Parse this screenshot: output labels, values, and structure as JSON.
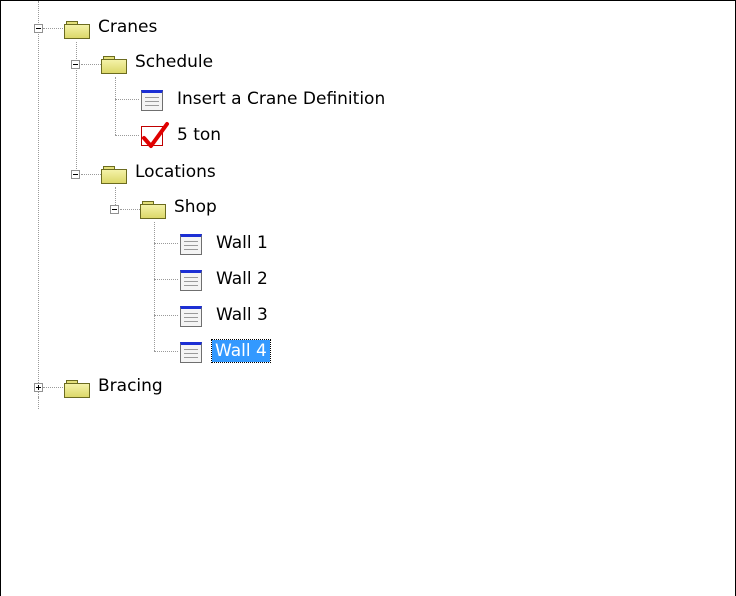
{
  "tree": {
    "cranes": {
      "label": "Cranes",
      "icon": "folder-icon",
      "expanded": true
    },
    "schedule": {
      "label": "Schedule",
      "icon": "folder-icon",
      "expanded": true
    },
    "insert_crane_definition": {
      "label": "Insert a Crane Definition",
      "icon": "document-icon"
    },
    "five_ton": {
      "label": "5 ton",
      "icon": "checkmark-icon"
    },
    "locations": {
      "label": "Locations",
      "icon": "folder-icon",
      "expanded": true
    },
    "shop": {
      "label": "Shop",
      "icon": "folder-icon",
      "expanded": true
    },
    "walls": [
      {
        "label": "Wall 1",
        "icon": "document-icon",
        "selected": false
      },
      {
        "label": "Wall 2",
        "icon": "document-icon",
        "selected": false
      },
      {
        "label": "Wall 3",
        "icon": "document-icon",
        "selected": false
      },
      {
        "label": "Wall 4",
        "icon": "document-icon",
        "selected": true
      }
    ],
    "bracing": {
      "label": "Bracing",
      "icon": "folder-icon",
      "expanded": false
    }
  },
  "colors": {
    "selection": "#3399ff",
    "folder": "#e4e07a",
    "document_header": "#1c2fd4",
    "checkmark": "#e00000"
  }
}
